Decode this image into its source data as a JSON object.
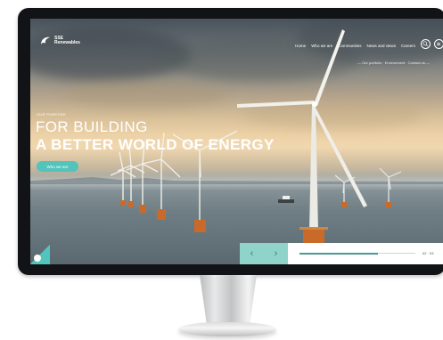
{
  "brand": {
    "name_line1": "SSE",
    "name_line2": "Renewables"
  },
  "nav": {
    "items": [
      "Home",
      "Who we are",
      "Communities",
      "News and views",
      "Careers"
    ]
  },
  "subnav": {
    "text": "— Our portfolio · Environment · Contact us —"
  },
  "hero": {
    "eyebrow": "OUR PURPOSE",
    "title_line1": "FOR BUILDING",
    "title_line2": "A BETTER WORLD OF ENERGY",
    "cta_label": "Who we are"
  },
  "slider": {
    "prev_arrow": "‹",
    "next_arrow": "›",
    "progress": 0.68,
    "counter": "02 · 03"
  },
  "icons": {
    "logo": "sse-swirl-icon",
    "search": "search-icon",
    "menu": "menu-icon",
    "corner": "chat-icon"
  },
  "colors": {
    "accent": "#52c4bb",
    "bezel": "#121316",
    "slider_arrows_bg": "#8fd3cb"
  }
}
